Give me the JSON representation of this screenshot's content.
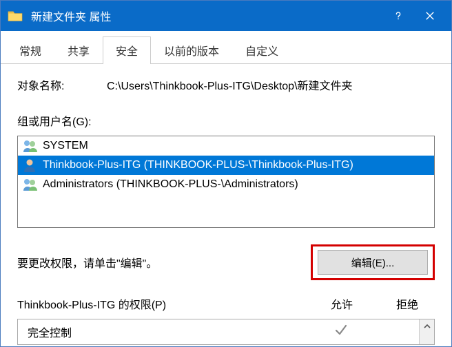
{
  "title": "新建文件夹 属性",
  "tabs": [
    {
      "label": "常规"
    },
    {
      "label": "共享"
    },
    {
      "label": "安全",
      "active": true
    },
    {
      "label": "以前的版本"
    },
    {
      "label": "自定义"
    }
  ],
  "object_name_label": "对象名称:",
  "object_name_value": "C:\\Users\\Thinkbook-Plus-ITG\\Desktop\\新建文件夹",
  "groups_label": "组或用户名(G):",
  "principals": [
    {
      "name": "SYSTEM",
      "type": "group"
    },
    {
      "name": "Thinkbook-Plus-ITG (THINKBOOK-PLUS-\\Thinkbook-Plus-ITG)",
      "type": "user",
      "selected": true
    },
    {
      "name": "Administrators (THINKBOOK-PLUS-\\Administrators)",
      "type": "group"
    }
  ],
  "edit_hint": "要更改权限，请单击\"编辑\"。",
  "edit_button": "编辑(E)...",
  "perm_header_title": "Thinkbook-Plus-ITG 的权限(P)",
  "perm_allow_label": "允许",
  "perm_deny_label": "拒绝",
  "permissions": [
    {
      "name": "完全控制",
      "allow": true,
      "deny": false
    }
  ],
  "icons": {
    "folder": "folder-icon",
    "help": "help-icon",
    "close": "close-icon",
    "group": "group-icon",
    "user": "user-icon",
    "check": "check-icon",
    "scroll_up": "chevron-up-icon"
  }
}
